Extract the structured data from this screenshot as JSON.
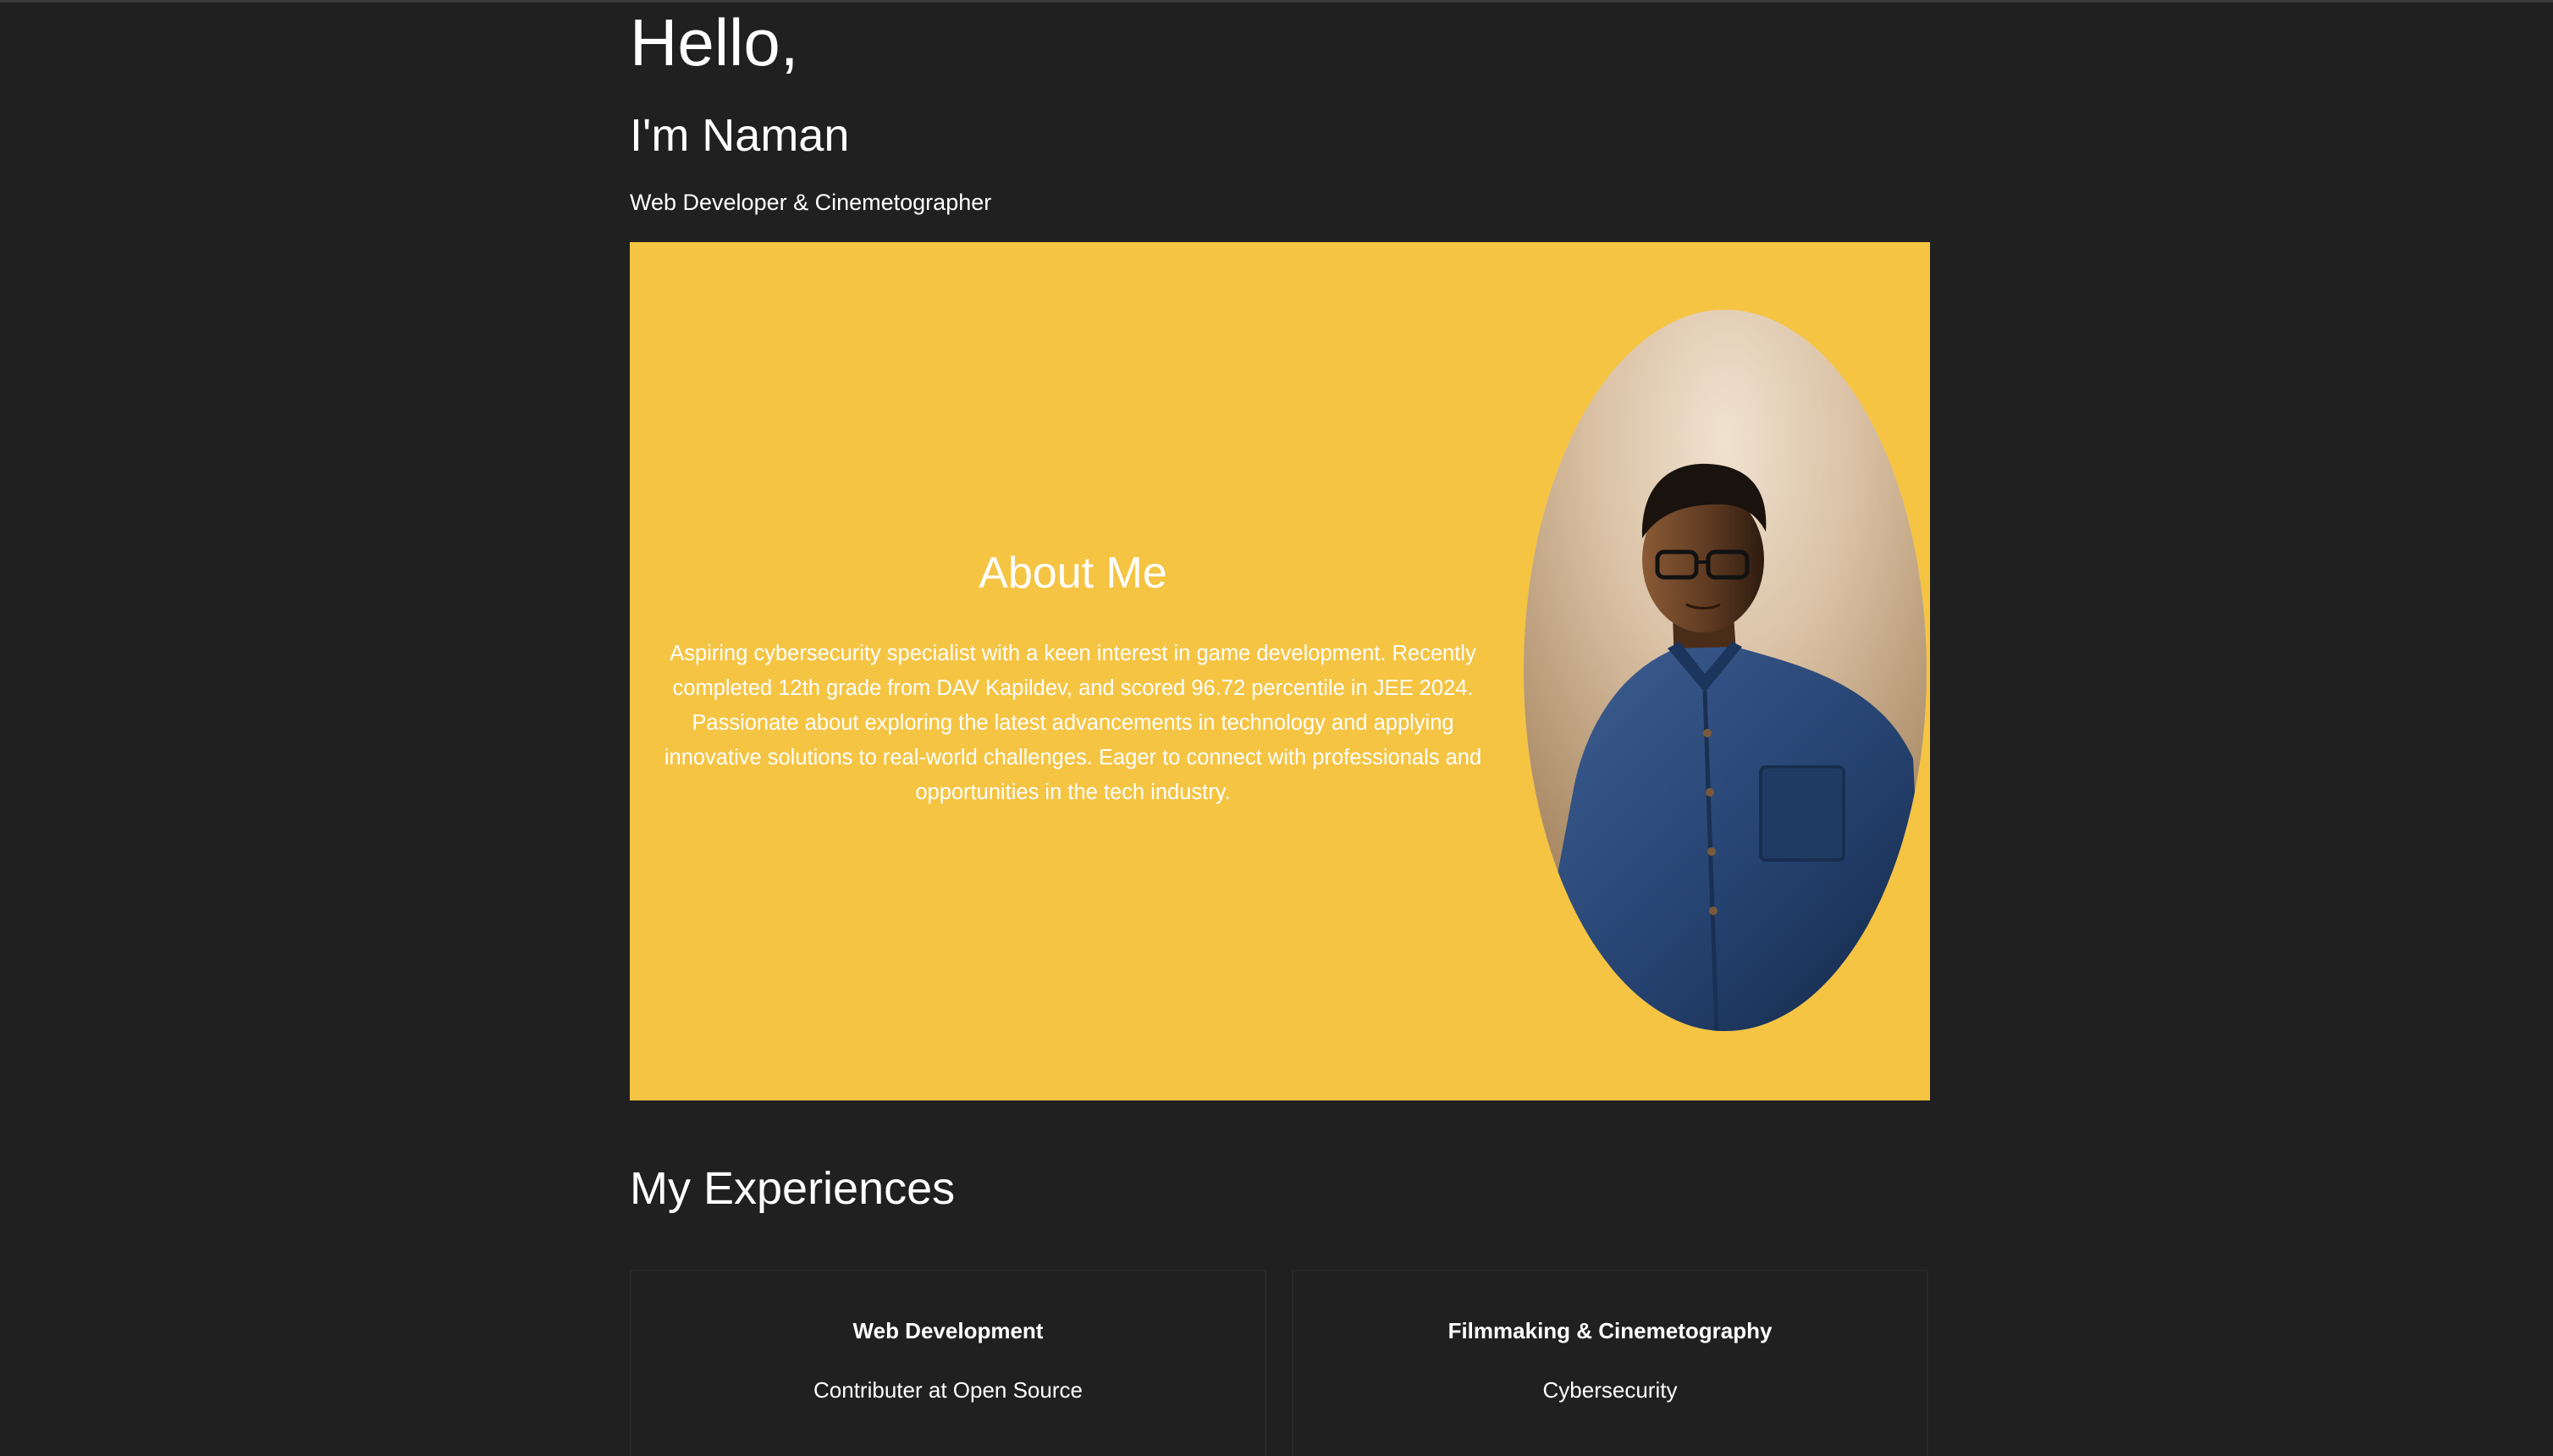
{
  "hero": {
    "greeting": "Hello,",
    "name": "I'm Naman",
    "tagline": "Web Developer & Cinemetographer"
  },
  "about": {
    "title": "About Me",
    "text": "Aspiring cybersecurity specialist with a keen interest in game development. Recently completed 12th grade from DAV Kapildev, and scored 96.72 percentile in JEE 2024. Passionate about exploring the latest advancements in technology and applying innovative solutions to real-world challenges. Eager to connect with professionals and opportunities in the tech industry.",
    "background_color": "#f5c443",
    "portrait": "profile-photo"
  },
  "experiences": {
    "title": "My Experiences",
    "cards": [
      {
        "title": "Web Development",
        "subtitle": "Contributer at Open Source"
      },
      {
        "title": "Filmmaking & Cinemetography",
        "subtitle": "Cybersecurity"
      }
    ]
  },
  "colors": {
    "page_background": "#202020",
    "accent": "#f5c443",
    "text": "#ffffff"
  }
}
